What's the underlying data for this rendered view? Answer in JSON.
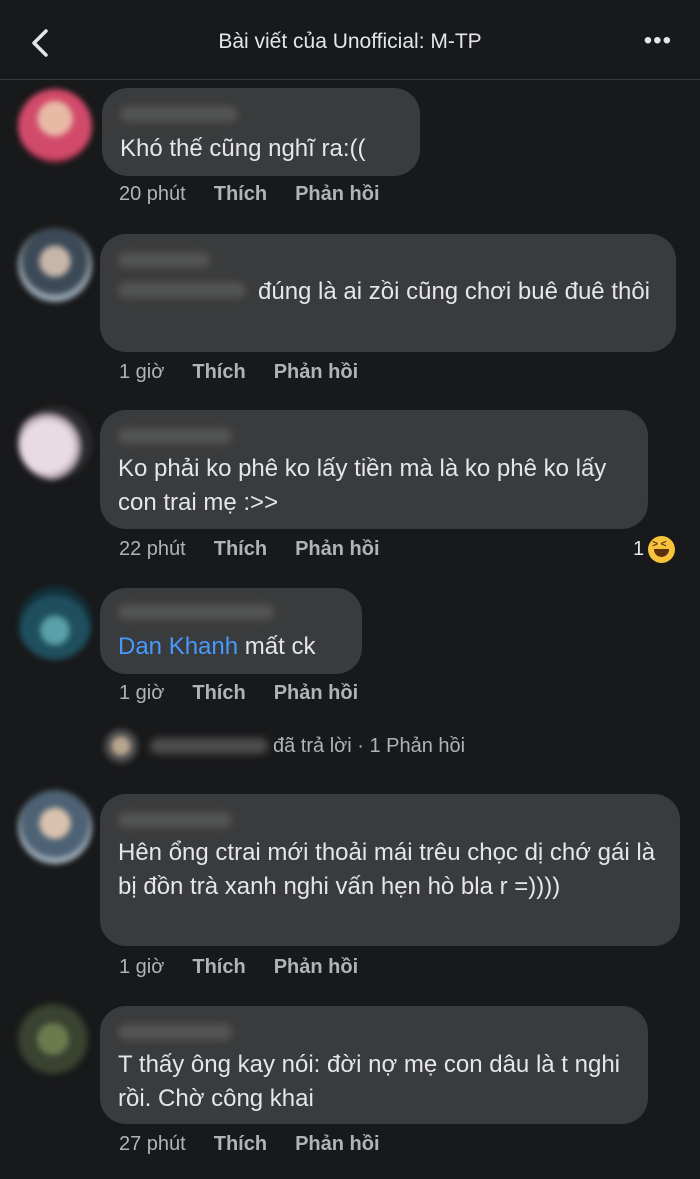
{
  "header": {
    "title": "Bài viết của Unofficial: M-TP",
    "more_icon": "•••"
  },
  "actions": {
    "like": "Thích",
    "reply": "Phản hồi"
  },
  "comments": [
    {
      "text": "Khó thế cũng nghĩ ra:((",
      "time": "20 phút"
    },
    {
      "text": "đúng là ai zồi cũng chơi buê đuê thôi",
      "time": "1 giờ"
    },
    {
      "text": "Ko phải ko phê ko lấy tiền mà là ko phê ko lấy con trai mẹ :>>",
      "time": "22 phút",
      "reaction_count": "1",
      "reaction_icon": "haha-emoji-icon"
    },
    {
      "mention": "Dan Khanh",
      "text": " mất ck",
      "time": "1 giờ",
      "replies_label": "đã trả lời · 1 Phản hồi"
    },
    {
      "text": "Hên ổng ctrai mới thoải mái trêu chọc dị chớ gái là bị đồn trà xanh nghi vấn hẹn hò bla r =))))",
      "time": "1 giờ"
    },
    {
      "text": "T thấy ông kay nói: đời nợ mẹ con dâu là t nghi rồi. Chờ công khai",
      "time": "27 phút"
    }
  ]
}
